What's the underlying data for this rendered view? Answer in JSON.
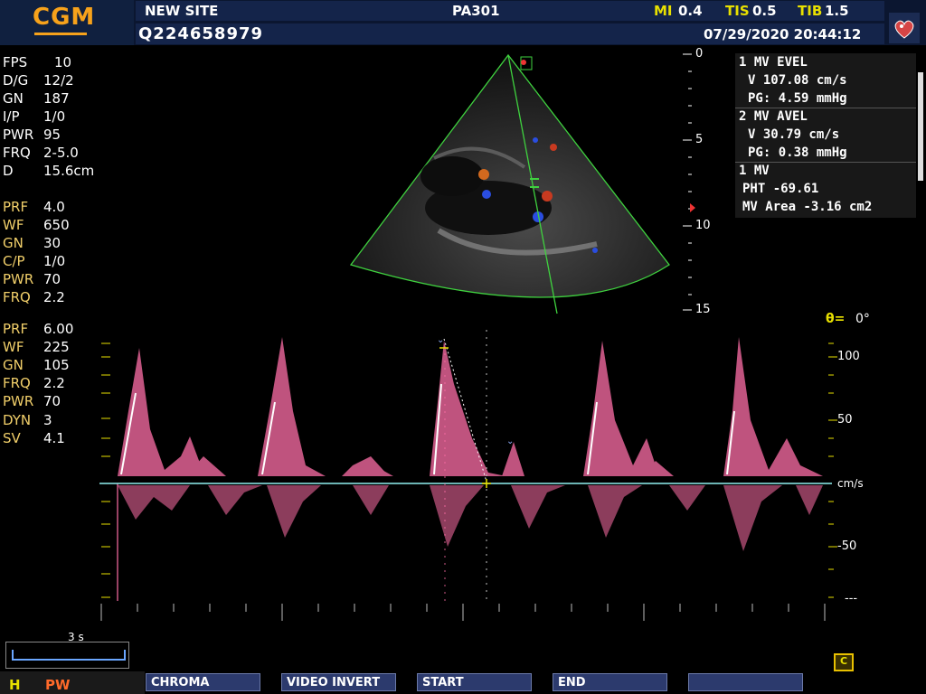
{
  "header": {
    "logo": "CGM",
    "site": "NEW SITE",
    "probe": "PA301",
    "mi_label": "MI",
    "mi_value": "0.4",
    "tis_label": "TIS",
    "tis_value": "0.5",
    "tib_label": "TIB",
    "tib_value": "1.5",
    "patient_id": "Q224658979",
    "datetime": "07/29/2020 20:44:12"
  },
  "params_2d": [
    {
      "label": "FPS",
      "value": "10"
    },
    {
      "label": "D/G",
      "value": "12/2"
    },
    {
      "label": "GN",
      "value": "187"
    },
    {
      "label": "I/P",
      "value": "1/0"
    },
    {
      "label": "PWR",
      "value": "95"
    },
    {
      "label": "FRQ",
      "value": "2-5.0"
    },
    {
      "label": "D",
      "value": "15.6cm"
    }
  ],
  "params_color": [
    {
      "label": "PRF",
      "value": "4.0"
    },
    {
      "label": "WF",
      "value": "650"
    },
    {
      "label": "GN",
      "value": "30"
    },
    {
      "label": "C/P",
      "value": "1/0"
    },
    {
      "label": "PWR",
      "value": "70"
    },
    {
      "label": "FRQ",
      "value": "2.2"
    }
  ],
  "params_pw": [
    {
      "label": "PRF",
      "value": "6.00"
    },
    {
      "label": "WF",
      "value": "225"
    },
    {
      "label": "GN",
      "value": "105"
    },
    {
      "label": "FRQ",
      "value": "2.2"
    },
    {
      "label": "PWR",
      "value": "70"
    },
    {
      "label": "DYN",
      "value": "3"
    },
    {
      "label": "SV",
      "value": "4.1"
    }
  ],
  "measurements": {
    "r1": "1 MV EVEL",
    "r2": "V 107.08 cm/s",
    "r3": "PG: 4.59 mmHg",
    "r4": "2 MV AVEL",
    "r5": "V 30.79 cm/s",
    "r6": "PG: 0.38 mmHg",
    "r7": "1 MV",
    "r8": "PHT -69.61",
    "r9": "MV Area -3.16 cm2"
  },
  "depth_scale": {
    "ticks": [
      "0",
      "5",
      "10",
      "15"
    ]
  },
  "doppler": {
    "angle_label": "θ=",
    "angle_value": "0°",
    "scale": [
      "100",
      "50",
      "cm/s",
      "-50",
      "---"
    ]
  },
  "timebar": {
    "label": "3 s"
  },
  "mode": {
    "h": "H",
    "pw": "PW"
  },
  "softkeys": [
    "CHROMA",
    "VIDEO INVERT",
    "START",
    "END",
    ""
  ],
  "icons": {
    "cine": "C"
  },
  "colors": {
    "accent": "#f7a21b",
    "header_bg": "#14244a",
    "baseline": "#8ff0f0",
    "spectrum": "#ff6fa8"
  }
}
